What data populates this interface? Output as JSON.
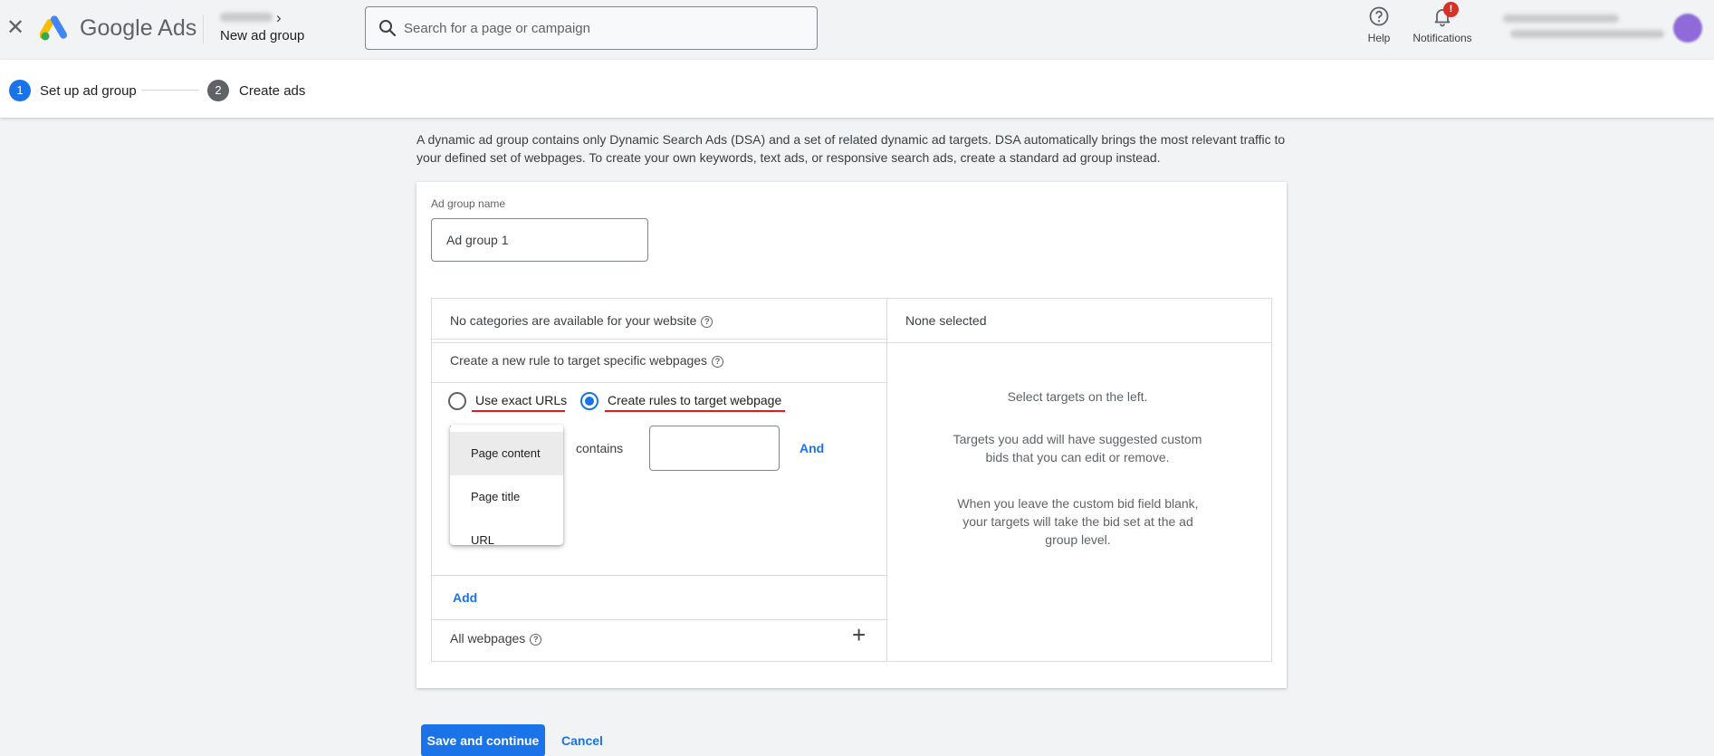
{
  "header": {
    "brand": "Google Ads",
    "page_name": "New ad group",
    "search_placeholder": "Search for a page or campaign",
    "help_label": "Help",
    "notifications_label": "Notifications",
    "notifications_badge": "!"
  },
  "stepper": {
    "steps": [
      {
        "number": "1",
        "label": "Set up ad group"
      },
      {
        "number": "2",
        "label": "Create ads"
      }
    ]
  },
  "description": "A dynamic ad group contains only Dynamic Search Ads (DSA) and a set of related dynamic ad targets. DSA automatically brings the most relevant traffic to your defined set of webpages. To create your own keywords, text ads, or responsive search ads, create a standard ad group instead.",
  "ad_group": {
    "label": "Ad group name",
    "value": "Ad group 1"
  },
  "targets": {
    "categories_text": "No categories are available for your website",
    "new_rule_text": "Create a new rule to target specific webpages",
    "radio_exact": "Use exact URLs",
    "radio_rules": "Create rules to target webpage",
    "selected_radio": "radio_rules",
    "operator": "contains",
    "rule_value": "",
    "and_link": "And",
    "dropdown_options": [
      "Page content",
      "Page title",
      "URL"
    ],
    "dropdown_selected": "Page content",
    "add_link": "Add",
    "all_webpages": "All webpages"
  },
  "selected_panel": {
    "title": "None selected",
    "line1": "Select targets on the left.",
    "line2": "Targets you add will have suggested custom bids that you can edit or remove.",
    "line3": "When you leave the custom bid field blank, your targets will take the bid set at the ad group level."
  },
  "footer": {
    "save_label": "Save and continue",
    "cancel_label": "Cancel"
  },
  "colors": {
    "accent": "#1a73e8",
    "underline": "#e5181d",
    "badge": "#d93025"
  }
}
